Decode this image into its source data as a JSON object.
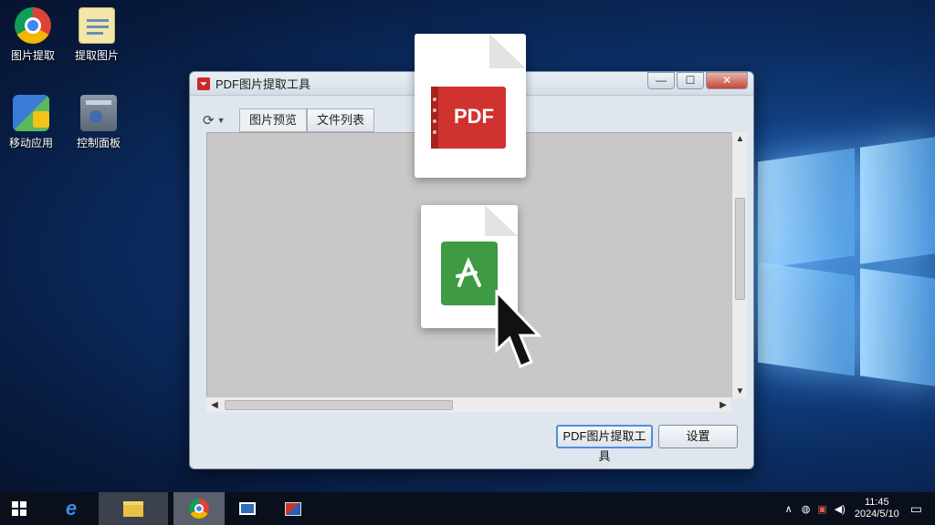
{
  "desktop": {
    "icons": [
      {
        "label": "图片提取",
        "icon": "chrome-icon"
      },
      {
        "label": "提取图片",
        "icon": "file-notes-icon"
      },
      {
        "label": "移动应用",
        "icon": "app-folder-icon"
      },
      {
        "label": "控制面板",
        "icon": "control-panel-icon"
      }
    ]
  },
  "window": {
    "title": "PDF图片提取工具",
    "controls": {
      "minimize": "—",
      "maximize": "☐",
      "close": "✕"
    },
    "toolbar": {
      "dropdown_icon": "refresh-dropdown-icon",
      "tabs": [
        "图片预览",
        "文件列表"
      ]
    },
    "buttons": {
      "extract": "PDF图片提取工具",
      "cancel": "设置"
    }
  },
  "overlay": {
    "pdf_badge": "PDF"
  },
  "taskbar": {
    "items": [
      "start-icon",
      "ie-icon",
      "file-explorer-icon",
      "chrome-icon",
      "mail-icon",
      "media-icon"
    ],
    "tray": {
      "time": "11:45",
      "date": "2024/5/10"
    }
  },
  "colors": {
    "pdf_red": "#d0332f",
    "acrobat_green": "#3e9a43",
    "accent_blue": "#4c8fd6"
  }
}
